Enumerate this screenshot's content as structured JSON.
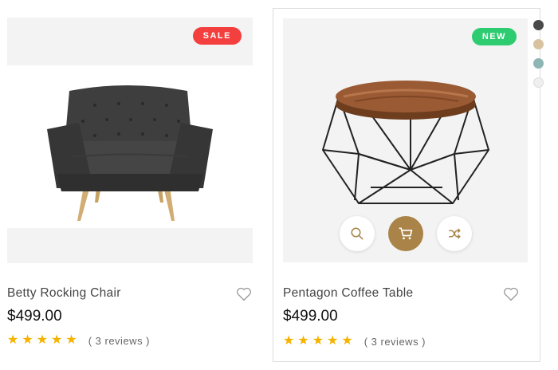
{
  "products": [
    {
      "badge": "SALE",
      "title": "Betty Rocking Chair",
      "price": "$499.00",
      "rating": 5,
      "reviews": "( 3 reviews )"
    },
    {
      "badge": "NEW",
      "title": "Pentagon Coffee Table",
      "price": "$499.00",
      "rating": 5,
      "reviews": "( 3 reviews )",
      "actions": [
        "search-icon",
        "cart-icon",
        "shuffle-icon"
      ],
      "swatches": [
        "#4a4a4a",
        "#d8c3a0",
        "#8fb6b6",
        "#efefef"
      ]
    }
  ],
  "colors": {
    "sale": "#f43f3f",
    "new": "#2ecc71",
    "accent": "#a98347",
    "star": "#f5b300"
  }
}
